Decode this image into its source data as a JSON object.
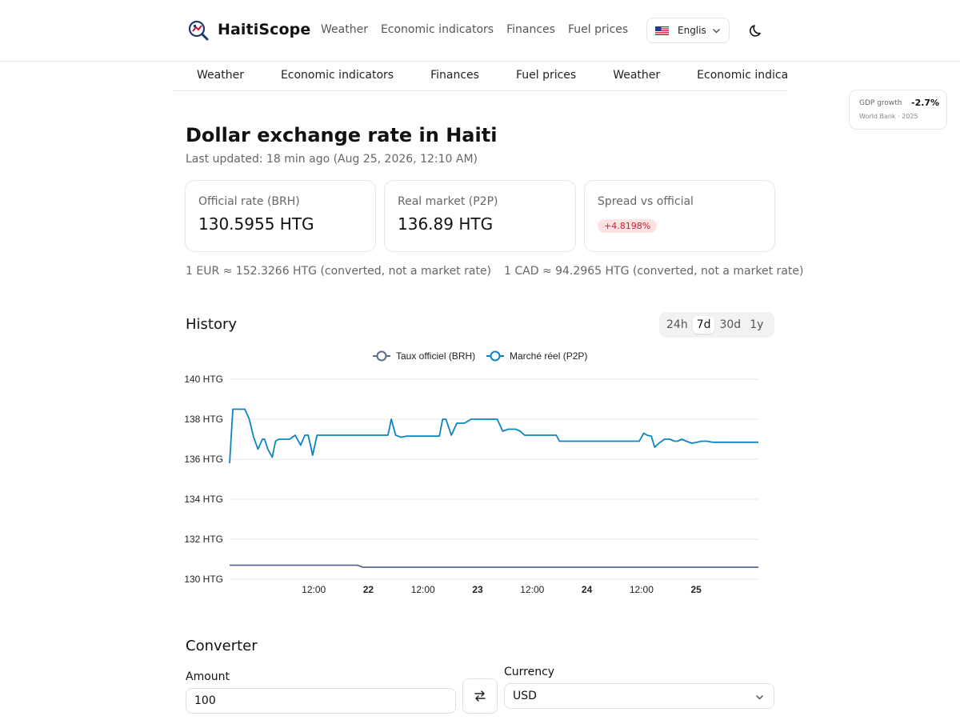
{
  "header": {
    "brand": "HaitiScope",
    "nav": [
      "Weather",
      "Economic indicators",
      "Finances",
      "Fuel prices"
    ],
    "language": "Englis"
  },
  "subnav": [
    "Weather",
    "Economic indicators",
    "Finances",
    "Fuel prices",
    "Weather",
    "Economic indicato"
  ],
  "gdp_badge": {
    "label": "GDP growth",
    "value": "-2.7%",
    "source": "World Bank · 2025"
  },
  "page": {
    "title": "Dollar exchange rate in Haiti",
    "last_updated": "Last updated: 18 min ago (Aug 25, 2026, 12:10 AM)"
  },
  "cards": {
    "official": {
      "label": "Official rate (BRH)",
      "value": "130.5955 HTG"
    },
    "market": {
      "label": "Real market (P2P)",
      "value": "136.89 HTG"
    },
    "spread": {
      "label": "Spread vs official",
      "value": "+4.8198%"
    }
  },
  "conversions": [
    "1 EUR ≈ 152.3266 HTG (converted, not a market rate)",
    "1 CAD ≈ 94.2965 HTG (converted, not a market rate)"
  ],
  "history": {
    "title": "History",
    "ranges": [
      "24h",
      "7d",
      "30d",
      "1y"
    ],
    "active_range": "7d"
  },
  "colors": {
    "official_series": "#5a6b8c",
    "market_series": "#0b84c1",
    "spread_badge_bg": "#fde2e4",
    "spread_badge_text": "#c81e2b"
  },
  "chart_data": {
    "type": "line",
    "legend": [
      "Taux officiel (BRH)",
      "Marché réel (P2P)"
    ],
    "legend_position": "top-center",
    "grid": true,
    "ylim": [
      130,
      140
    ],
    "xlim": [
      -0.27,
      4.57
    ],
    "y_ticks": [
      130,
      132,
      134,
      136,
      138,
      140
    ],
    "y_tick_labels": [
      "130 HTG",
      "132 HTG",
      "134 HTG",
      "136 HTG",
      "138 HTG",
      "140 HTG"
    ],
    "x_ticks": [
      0.5,
      1.0,
      1.5,
      2.0,
      2.5,
      3.0,
      3.5,
      4.0,
      4.5
    ],
    "x_tick_labels": [
      "12:00",
      "22",
      "12:00",
      "23",
      "12:00",
      "24",
      "12:00",
      "25"
    ],
    "x_tick_label_values": [
      0.5,
      1.0,
      1.5,
      2.0,
      2.5,
      3.0,
      3.5,
      4.0
    ],
    "x_tick_bold": [
      false,
      true,
      false,
      true,
      false,
      true,
      false,
      true
    ],
    "series": [
      {
        "name": "Taux officiel (BRH)",
        "x": [
          -0.27,
          0.7,
          0.82,
          0.9,
          0.95,
          2.0,
          3.0,
          4.0,
          4.57
        ],
        "values": [
          130.7,
          130.7,
          130.7,
          130.7,
          130.6,
          130.6,
          130.6,
          130.6,
          130.6
        ]
      },
      {
        "name": "Marché réel (P2P)",
        "x": [
          -0.27,
          -0.24,
          -0.19,
          -0.13,
          -0.09,
          -0.05,
          -0.01,
          0.03,
          0.05,
          0.08,
          0.12,
          0.15,
          0.18,
          0.21,
          0.25,
          0.28,
          0.33,
          0.38,
          0.42,
          0.45,
          0.49,
          0.53,
          0.57,
          0.6,
          0.64,
          0.67,
          0.72,
          0.77,
          0.82,
          0.87,
          0.92,
          0.97,
          1.02,
          1.08,
          1.13,
          1.18,
          1.21,
          1.25,
          1.3,
          1.35,
          1.4,
          1.45,
          1.5,
          1.55,
          1.6,
          1.65,
          1.68,
          1.71,
          1.76,
          1.81,
          1.88,
          1.94,
          2.0,
          2.03,
          2.06,
          2.09,
          2.13,
          2.18,
          2.23,
          2.28,
          2.32,
          2.35,
          2.39,
          2.43,
          2.48,
          2.53,
          2.58,
          2.64,
          2.68,
          2.72,
          2.75,
          2.79,
          2.83,
          2.88,
          2.93,
          2.98,
          3.03,
          3.08,
          3.13,
          3.18,
          3.23,
          3.28,
          3.33,
          3.38,
          3.43,
          3.48,
          3.52,
          3.55,
          3.59,
          3.62,
          3.66,
          3.71,
          3.76,
          3.8,
          3.83,
          3.87,
          3.91,
          3.96,
          4.01,
          4.05,
          4.1,
          4.15,
          4.2,
          4.26,
          4.33,
          4.39,
          4.45,
          4.51,
          4.57
        ],
        "values": [
          135.8,
          138.5,
          138.5,
          138.5,
          138.0,
          137.1,
          136.5,
          137.0,
          137.0,
          136.5,
          136.1,
          136.9,
          137.0,
          137.0,
          137.0,
          137.0,
          137.2,
          136.7,
          137.2,
          137.2,
          136.2,
          137.2,
          137.2,
          137.2,
          137.2,
          137.2,
          137.2,
          137.2,
          137.2,
          137.2,
          137.2,
          137.2,
          137.2,
          137.2,
          137.2,
          137.2,
          138.0,
          137.2,
          137.1,
          137.15,
          137.15,
          137.15,
          137.15,
          137.15,
          137.15,
          137.15,
          138.0,
          138.0,
          137.2,
          137.8,
          137.8,
          138.0,
          138.0,
          138.0,
          138.0,
          138.0,
          138.0,
          138.0,
          137.4,
          137.5,
          137.5,
          137.5,
          137.4,
          137.2,
          137.2,
          137.2,
          137.2,
          137.2,
          137.2,
          137.2,
          136.9,
          136.9,
          136.9,
          136.9,
          136.9,
          136.9,
          136.9,
          136.9,
          136.9,
          136.9,
          136.9,
          136.9,
          136.9,
          136.9,
          136.9,
          136.9,
          137.3,
          137.2,
          137.15,
          136.6,
          136.8,
          137.0,
          137.0,
          136.9,
          136.9,
          137.0,
          136.9,
          136.8,
          136.85,
          136.9,
          136.9,
          136.85,
          136.85,
          136.85,
          136.85,
          136.85,
          136.85,
          136.85,
          136.85
        ]
      }
    ]
  },
  "converter": {
    "title": "Converter",
    "amount_label": "Amount",
    "amount_value": "100",
    "currency_label": "Currency",
    "currency_value": "USD"
  }
}
